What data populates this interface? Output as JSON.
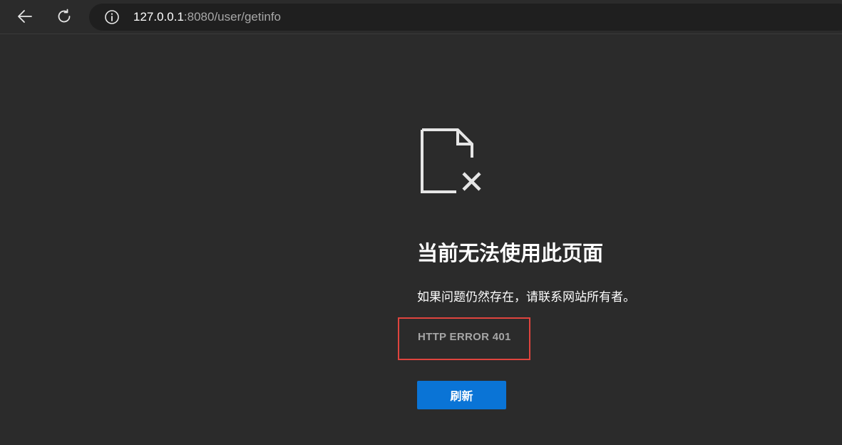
{
  "browser": {
    "back_icon": "arrow-left-icon",
    "refresh_icon": "refresh-icon",
    "info_icon": "info-circle-icon",
    "url_host": "127.0.0.1",
    "url_rest": ":8080/user/getinfo"
  },
  "error_page": {
    "icon": "document-error-icon",
    "title": "当前无法使用此页面",
    "description": "如果问题仍然存在，请联系网站所有者。",
    "error_code": "HTTP ERROR 401",
    "refresh_label": "刷新",
    "highlight_color": "#e0443e",
    "button_color": "#0a74d6"
  }
}
